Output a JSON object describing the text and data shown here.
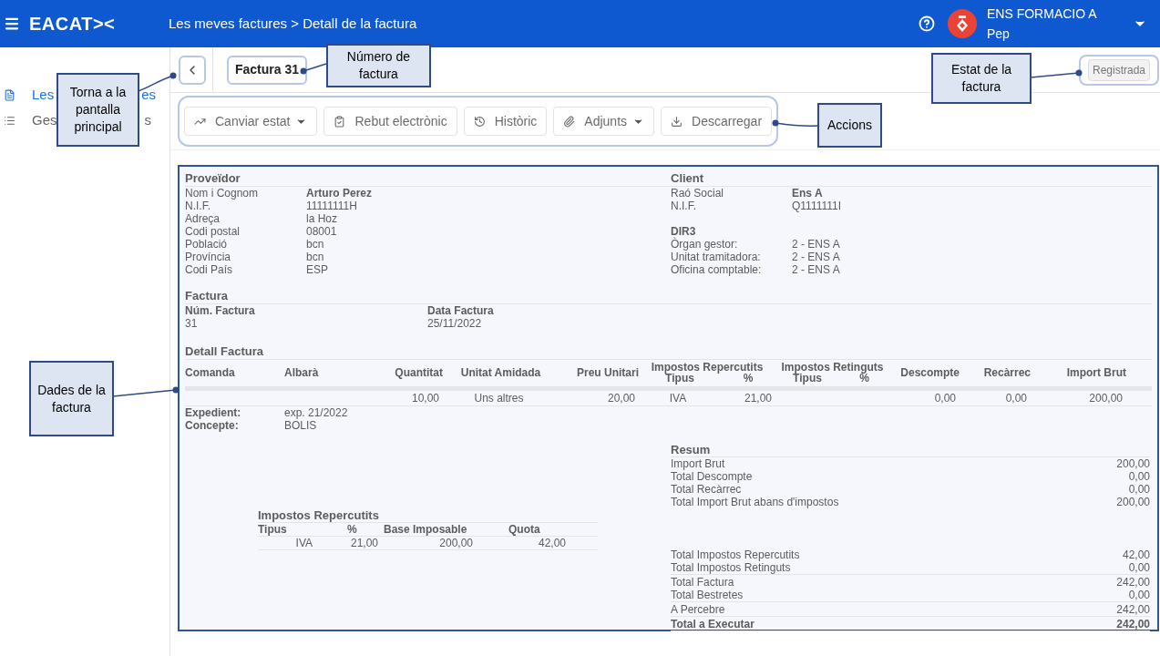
{
  "header": {
    "logo": "EACAT><",
    "breadcrumb": "Les meves factures > Detall de la factura",
    "organization": "ENS FORMACIO A",
    "user": "Pep"
  },
  "sidebar": {
    "items": [
      {
        "label_start": "Les",
        "label_end": "es",
        "selected": true
      },
      {
        "label_start": "Ges",
        "label_end": "s",
        "selected": false
      }
    ]
  },
  "invoice_bar": {
    "title": "Factura 31",
    "status": "Registrada"
  },
  "actions": [
    {
      "label": "Canviar estat",
      "menu": true
    },
    {
      "label": "Rebut electrònic",
      "menu": false
    },
    {
      "label": "Històric",
      "menu": false
    },
    {
      "label": "Adjunts",
      "menu": true
    },
    {
      "label": "Descarregar",
      "menu": false
    }
  ],
  "supplier": {
    "title": "Proveïdor",
    "fields": [
      {
        "label": "Nom i Cognom",
        "value": "Arturo Perez",
        "bold": true
      },
      {
        "label": "N.I.F.",
        "value": "11111111H",
        "bold": false
      },
      {
        "label": "Adreça",
        "value": "la Hoz",
        "bold": false
      },
      {
        "label": "Codi postal",
        "value": "08001",
        "bold": false
      },
      {
        "label": "Població",
        "value": "bcn",
        "bold": false
      },
      {
        "label": "Província",
        "value": "bcn",
        "bold": false
      },
      {
        "label": "Codi País",
        "value": "ESP",
        "bold": false
      }
    ]
  },
  "client": {
    "title": "Client",
    "fields": [
      {
        "label": "Raó Social",
        "value": "Ens A",
        "bold": true
      },
      {
        "label": "N.I.F.",
        "value": "Q1111111I",
        "bold": false
      }
    ],
    "dir3": {
      "title": "DIR3",
      "fields": [
        {
          "label": "Òrgan gestor:",
          "value": "2 - ENS A"
        },
        {
          "label": "Unitat tramitadora:",
          "value": "2 - ENS A"
        },
        {
          "label": "Oficina comptable:",
          "value": "2 - ENS A"
        }
      ]
    }
  },
  "invoice": {
    "title": "Factura",
    "fields": [
      {
        "label": "Núm. Factura",
        "value": "31"
      },
      {
        "label": "Data Factura",
        "value": "25/11/2022"
      }
    ]
  },
  "detail": {
    "title": "Detall Factura",
    "columns": [
      {
        "label": "Comanda",
        "kind": "plain"
      },
      {
        "label": "Albarà",
        "kind": "plain"
      },
      {
        "label": "Quantitat",
        "kind": "plain"
      },
      {
        "label": "Unitat Amidada",
        "kind": "plain"
      },
      {
        "label": "Preu Unitari",
        "kind": "plain"
      },
      {
        "label": "Tipus",
        "kind": "grouped",
        "group": "Impostos Repercutits"
      },
      {
        "label": "%",
        "kind": "grouped"
      },
      {
        "label": "Tipus",
        "kind": "grouped",
        "group": "Impostos Retinguts"
      },
      {
        "label": "%",
        "kind": "grouped"
      },
      {
        "label": "Descompte",
        "kind": "plain"
      },
      {
        "label": "Recàrrec",
        "kind": "plain"
      },
      {
        "label": "Import Brut",
        "kind": "plain"
      }
    ],
    "rows": [
      [
        null,
        null,
        "10,00",
        "Uns altres",
        "20,00",
        "IVA",
        "21,00",
        null,
        null,
        "0,00",
        "0,00",
        "200,00"
      ]
    ],
    "extra": [
      {
        "label": "Expedient:",
        "value": "exp. 21/2022"
      },
      {
        "label": "Concepte:",
        "value": "BOLIS"
      }
    ]
  },
  "taxes": {
    "title": "Impostos Repercutits",
    "columns": [
      "Tipus",
      "%",
      "Base Imposable",
      "Quota"
    ],
    "rows": [
      [
        "IVA",
        "21,00",
        "200,00",
        "42,00"
      ]
    ]
  },
  "summary": {
    "title": "Resum",
    "groups": [
      [
        {
          "label": "Import Brut",
          "value": "200,00",
          "kind": "plain"
        },
        {
          "label": "Total Descompte",
          "value": "0,00",
          "kind": "plain"
        },
        {
          "label": "Total Recàrrec",
          "value": "0,00",
          "kind": "plain"
        },
        {
          "label": "Total Import Brut abans d'impostos",
          "value": "200,00",
          "kind": "plain"
        }
      ],
      [
        {
          "label": "Total Impostos Repercutits",
          "value": "42,00",
          "kind": "plain"
        },
        {
          "label": "Total Impostos Retinguts",
          "value": "0,00",
          "kind": "plain"
        },
        {
          "label": "Total Factura",
          "value": "242,00",
          "kind": "subtotal"
        },
        {
          "label": "Total Bestretes",
          "value": "0,00",
          "kind": "plain"
        },
        {
          "label": "A Percebre",
          "value": "242,00",
          "kind": "subtotal"
        },
        {
          "label": "Total a Executar",
          "value": "242,00",
          "kind": "total"
        }
      ]
    ]
  },
  "callouts": [
    {
      "text": "Torna a la pantalla principal"
    },
    {
      "text": "Número de factura"
    },
    {
      "text": "Estat de la factura"
    },
    {
      "text": "Accions"
    },
    {
      "text": "Dades de la factura"
    }
  ]
}
